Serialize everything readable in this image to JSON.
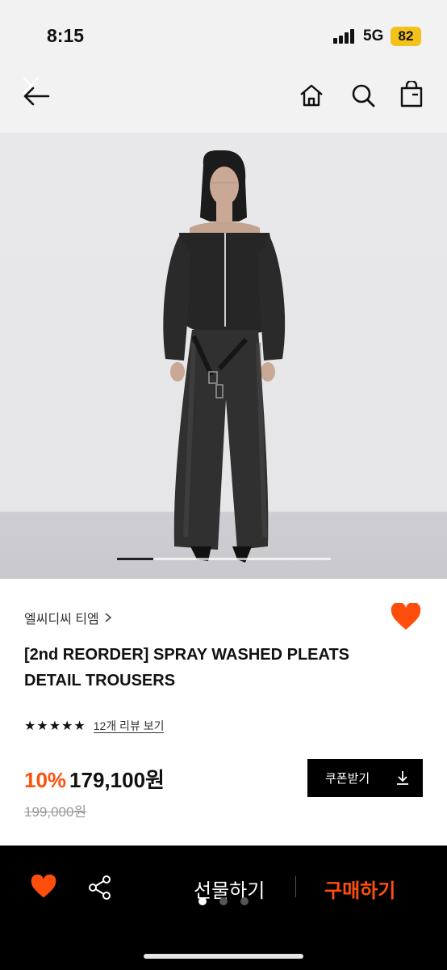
{
  "status_bar": {
    "time": "8:15",
    "network": "5G",
    "battery": "82"
  },
  "product": {
    "brand": "엘씨디씨 티엠",
    "title": "[2nd REORDER] SPRAY WASHED PLEATS DETAIL TROUSERS",
    "rating": 5,
    "review_link": "12개 리뷰 보기",
    "discount": "10%",
    "price": "179,100원",
    "original_price": "199,000원",
    "image_count_progress": 0.17
  },
  "buttons": {
    "coupon": "쿠폰받기",
    "gift": "선물하기",
    "buy": "구매하기"
  },
  "colors": {
    "accent": "#ff4e0c",
    "dark": "#000000"
  }
}
